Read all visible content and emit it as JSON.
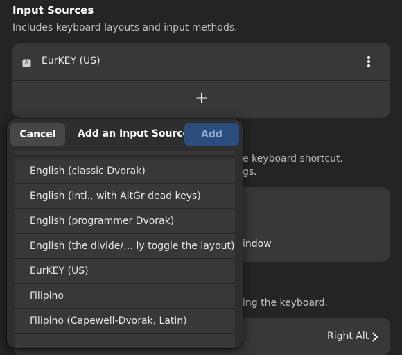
{
  "input_sources": {
    "title": "Input Sources",
    "subtitle": "Includes keyboard layouts and input methods.",
    "items": [
      {
        "label": "EurKEY (US)"
      }
    ],
    "add_glyph": "+"
  },
  "background": {
    "shortcut_partial": "e keyboard shortcut.",
    "shortcut_partial2": "gs.",
    "window_partial": "indow",
    "keyboard_partial": "ing the keyboard.",
    "compose_value": "Right Alt"
  },
  "dialog": {
    "cancel_label": "Cancel",
    "title": "Add an Input Source",
    "add_label": "Add",
    "rows": [
      "English (classic Dvorak)",
      "English (intl., with AltGr dead keys)",
      "English (programmer Dvorak)",
      "English (the divide/…    ly toggle the layout)",
      "EurKEY (US)",
      "Filipino",
      "Filipino (Capewell-Dvorak, Latin)"
    ]
  },
  "colors": {
    "accent": "#2a4d7e",
    "card": "#383838",
    "window_bg": "#242424"
  }
}
